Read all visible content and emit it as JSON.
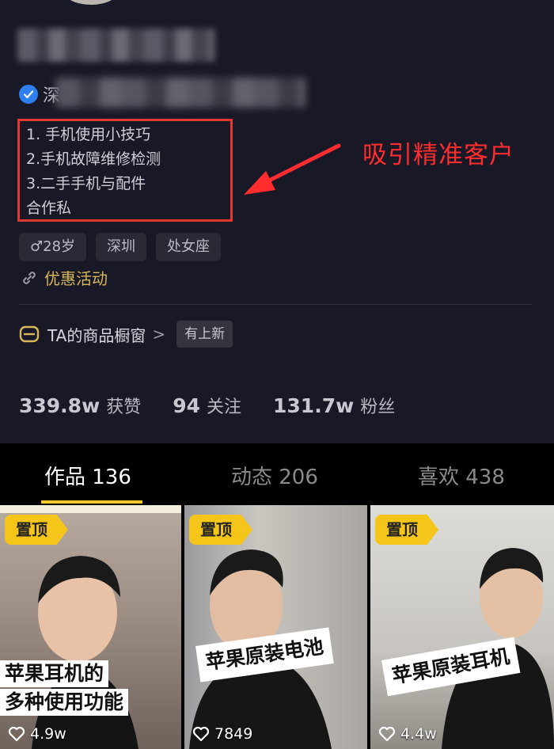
{
  "profile": {
    "verified_char": "深",
    "bio": [
      "1. 手机使用小技巧",
      "2.手机故障维修检测",
      "3.二手手机与配件",
      "合作私"
    ],
    "tags": [
      "♂28岁",
      "深圳",
      "处女座"
    ],
    "promo": "优惠活动",
    "shop": {
      "label": "TA的商品橱窗",
      "chevron": ">",
      "badge": "有上新"
    },
    "stats": [
      {
        "num": "339.8w",
        "label": "获赞"
      },
      {
        "num": "94",
        "label": "关注"
      },
      {
        "num": "131.7w",
        "label": "粉丝"
      }
    ]
  },
  "annotation": "吸引精准客户",
  "tabs": [
    {
      "label": "作品 136"
    },
    {
      "label": "动态 206"
    },
    {
      "label": "喜欢 438"
    }
  ],
  "videos": [
    {
      "pin": "置顶",
      "caption_lines": [
        "苹果耳机的",
        "多种使用功能"
      ],
      "likes": "4.9w"
    },
    {
      "pin": "置顶",
      "caption_lines": [
        "苹果原装电池"
      ],
      "likes": "7849"
    },
    {
      "pin": "置顶",
      "caption_lines": [
        "苹果原装耳机"
      ],
      "likes": "4.4w"
    }
  ],
  "colors": {
    "accent": "#f7c72b",
    "annotation": "#ff2d2d",
    "promo": "#d7b75a",
    "verify": "#2e7ff0"
  }
}
